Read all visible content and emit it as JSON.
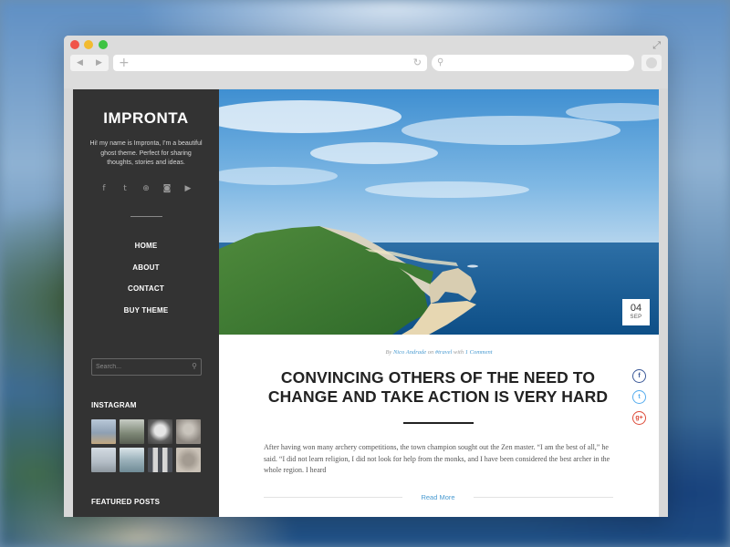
{
  "browser": {
    "url": "",
    "search_placeholder": ""
  },
  "sidebar": {
    "brand": "IMPRONTA",
    "tagline": "Hi! my name is Impronta, I'm a beautiful ghost theme. Perfect for sharing thoughts, stories and ideas.",
    "social_icons": [
      "facebook-icon",
      "twitter-icon",
      "dribbble-icon",
      "instagram-icon",
      "youtube-icon"
    ],
    "nav": [
      {
        "label": "HOME"
      },
      {
        "label": "ABOUT"
      },
      {
        "label": "CONTACT"
      },
      {
        "label": "BUY THEME"
      }
    ],
    "search_placeholder": "Search...",
    "instagram_heading": "INSTAGRAM",
    "instagram_thumbs": [
      "#8da3b8",
      "#7f8a7a",
      "#6a6a6a",
      "#9a9690",
      "#bcc4cb",
      "#9fb1b9",
      "#5a5e66",
      "#b7b1aa"
    ],
    "featured_heading": "FEATURED POSTS"
  },
  "post": {
    "date_day": "04",
    "date_month": "SEP",
    "meta_by": "By",
    "author": "Nico Andrade",
    "meta_on": "on",
    "tag": "#travel",
    "meta_with": "with",
    "comments": "1 Comment",
    "title": "CONVINCING OTHERS OF THE NEED TO CHANGE AND TAKE ACTION IS VERY HARD",
    "excerpt": "After having won many archery competitions, the town champion sought out the Zen master. “I am the best of all,” he said. “I did not learn religion, I did not look for help from the monks, and I have been considered the best archer in the whole region. I heard",
    "read_more": "Read More",
    "share_icons": [
      {
        "name": "facebook-share-icon",
        "glyph": "f"
      },
      {
        "name": "twitter-share-icon",
        "glyph": "t"
      },
      {
        "name": "googleplus-share-icon",
        "glyph": "g+"
      }
    ]
  },
  "colors": {
    "sidebar_bg": "#333333",
    "link": "#4a9bd1"
  }
}
